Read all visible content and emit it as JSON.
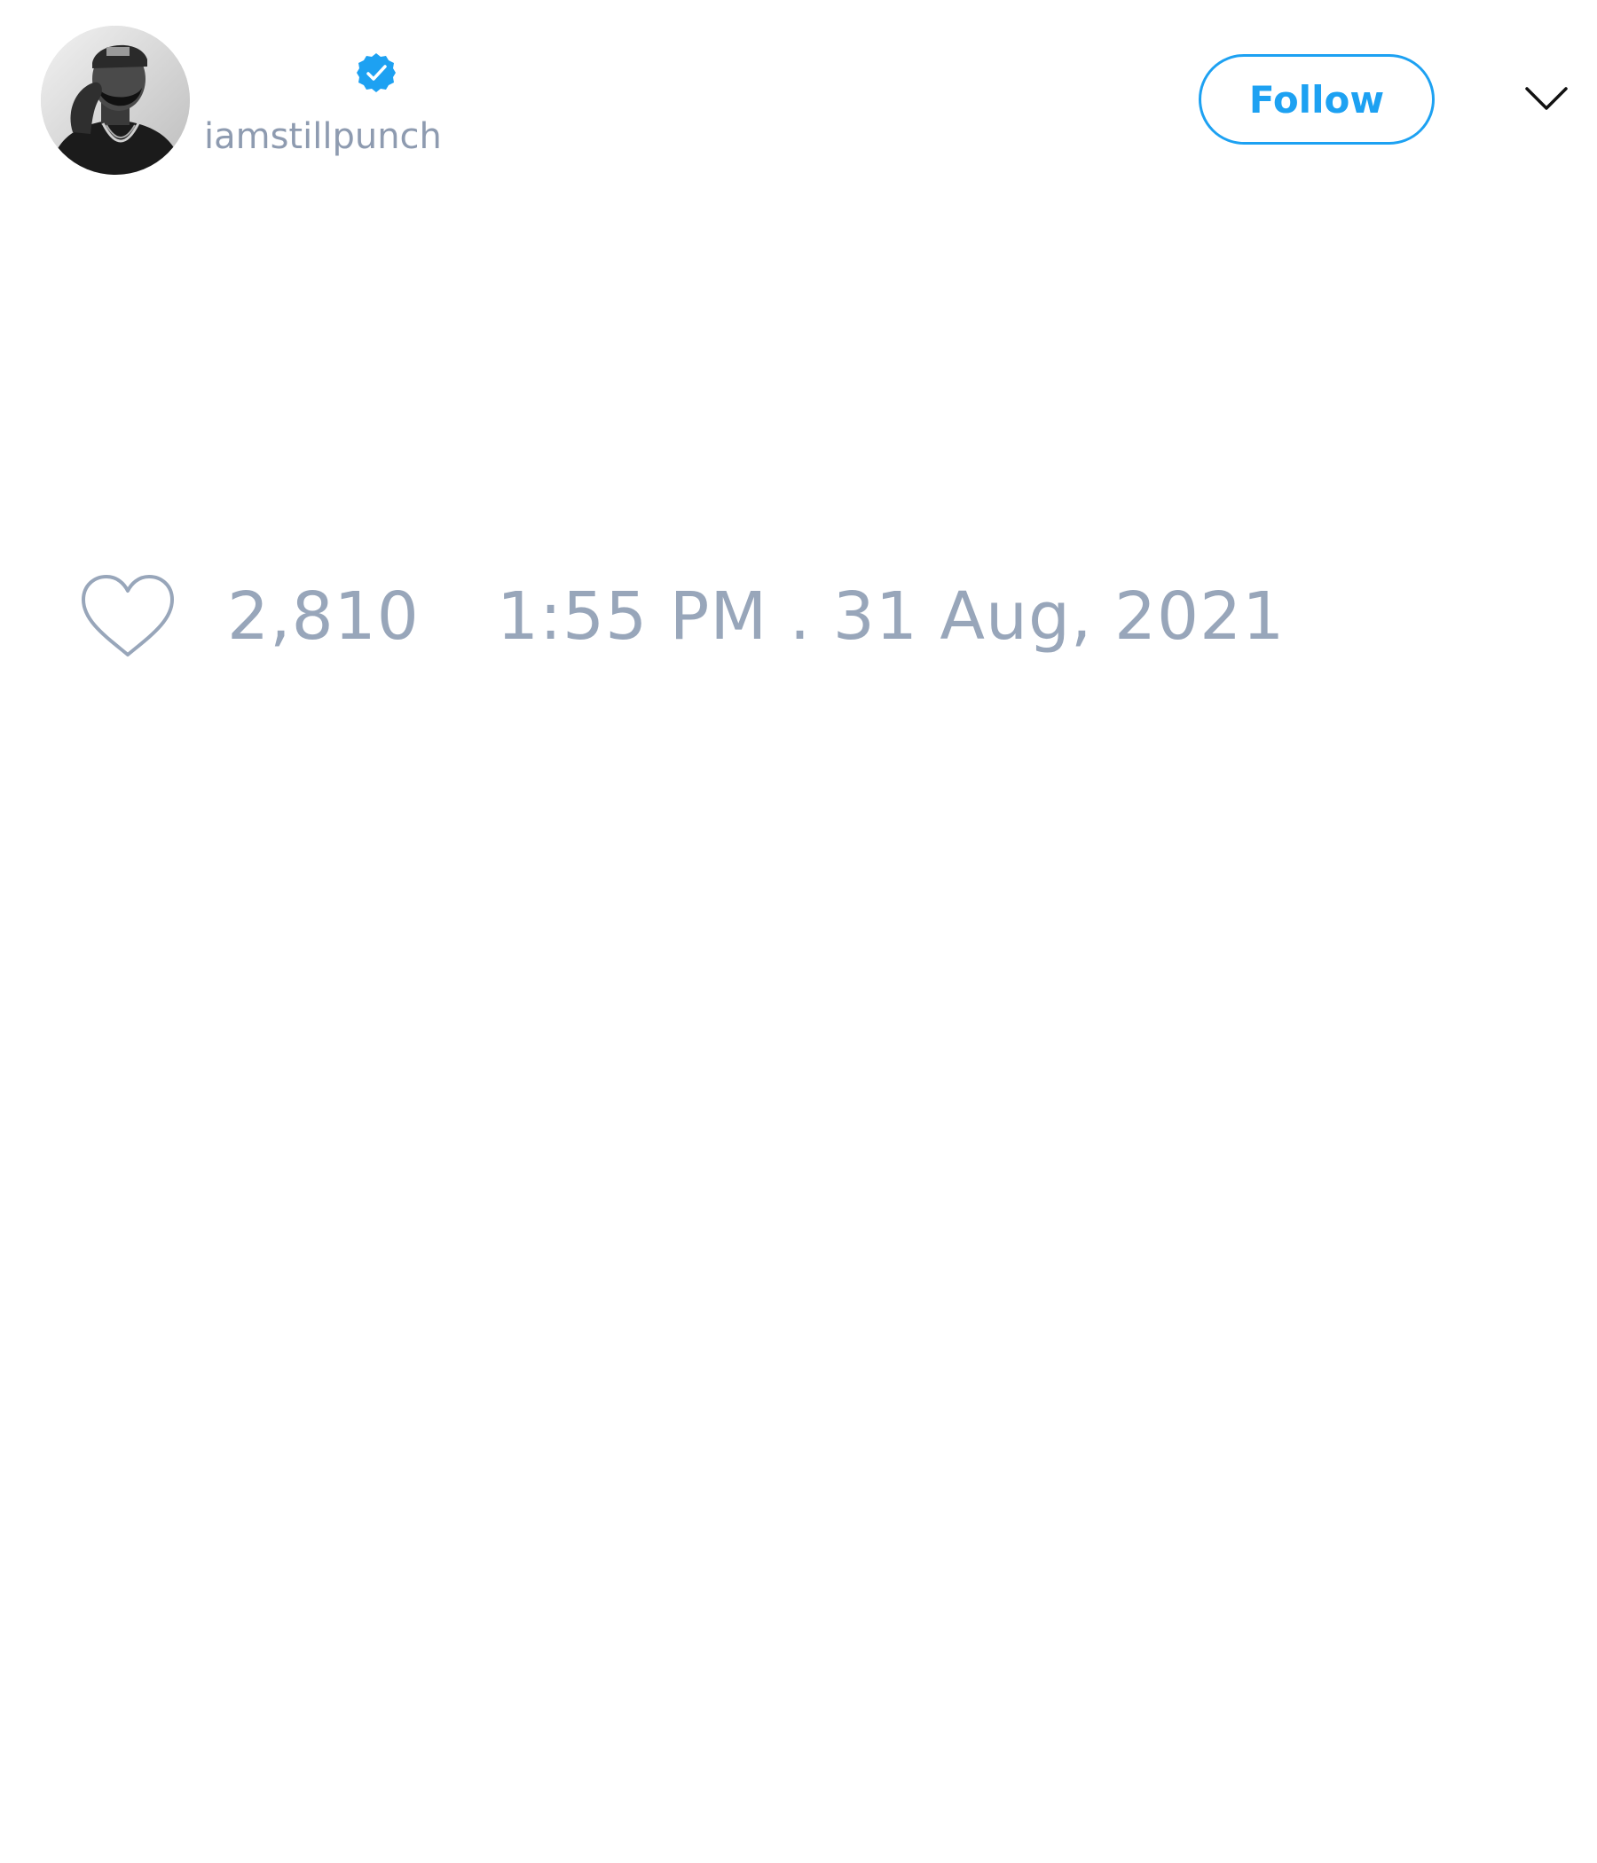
{
  "author": {
    "display_name": "",
    "handle": "iamstillpunch",
    "verified": true
  },
  "header": {
    "follow_label": "Follow",
    "menu_icon": "chevron-down-icon"
  },
  "tweet": {
    "like_count": "2,810",
    "timestamp": "1:55 PM . 31 Aug, 2021",
    "like_icon": "heart-icon"
  },
  "colors": {
    "accent": "#1da1f2",
    "muted_text": "#98a6ba",
    "background": "#ffffff"
  }
}
